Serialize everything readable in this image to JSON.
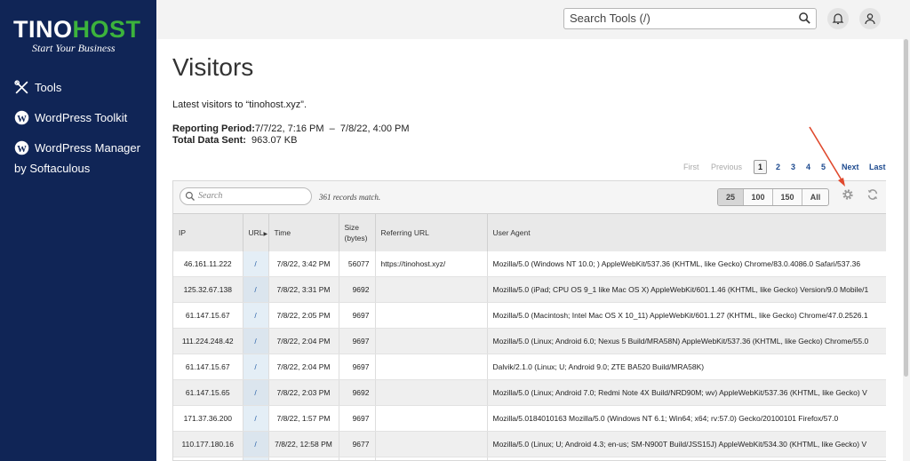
{
  "brand": {
    "name_part1": "TINO",
    "name_part2": "HOST",
    "tagline": "Start Your Business"
  },
  "sidebar": {
    "items": [
      {
        "label": "Tools",
        "icon": "tools-icon"
      },
      {
        "label": "WordPress Toolkit",
        "icon": "wordpress-icon"
      },
      {
        "label": "WordPress Manager",
        "icon": "wordpress-icon"
      }
    ],
    "sub_label": "by Softaculous"
  },
  "header": {
    "search_placeholder": "Search Tools (/)"
  },
  "page": {
    "title": "Visitors",
    "intro": "Latest visitors to “tinohost.xyz”.",
    "period_label": "Reporting Period:",
    "period_value": "7/7/22, 7:16 PM  –  7/8/22, 4:00 PM",
    "total_label": "Total Data Sent:",
    "total_value": "963.07 KB"
  },
  "pager": {
    "first": "First",
    "previous": "Previous",
    "pages": [
      "1",
      "2",
      "3",
      "4",
      "5"
    ],
    "current": "1",
    "next": "Next",
    "last": "Last"
  },
  "table": {
    "search_placeholder": "Search",
    "records": "361 records match.",
    "page_sizes": [
      "25",
      "100",
      "150",
      "All"
    ],
    "active_page_size": "25",
    "headers": {
      "ip": "IP",
      "url": "URL",
      "time": "Time",
      "size": "Size (bytes)",
      "referrer": "Referring URL",
      "agent": "User Agent"
    },
    "rows": [
      {
        "ip": "46.161.11.222",
        "url": "/",
        "time": "7/8/22, 3:42 PM",
        "size": "56077",
        "referrer": "https://tinohost.xyz/",
        "agent": "Mozilla/5.0 (Windows NT 10.0; ) AppleWebKit/537.36 (KHTML, like Gecko) Chrome/83.0.4086.0 Safari/537.36"
      },
      {
        "ip": "125.32.67.138",
        "url": "/",
        "time": "7/8/22, 3:31 PM",
        "size": "9692",
        "referrer": "",
        "agent": "Mozilla/5.0 (iPad; CPU OS 9_1 like Mac OS X) AppleWebKit/601.1.46 (KHTML, like Gecko) Version/9.0 Mobile/1"
      },
      {
        "ip": "61.147.15.67",
        "url": "/",
        "time": "7/8/22, 2:05 PM",
        "size": "9697",
        "referrer": "",
        "agent": "Mozilla/5.0 (Macintosh; Intel Mac OS X 10_11) AppleWebKit/601.1.27 (KHTML, like Gecko) Chrome/47.0.2526.1"
      },
      {
        "ip": "111.224.248.42",
        "url": "/",
        "time": "7/8/22, 2:04 PM",
        "size": "9697",
        "referrer": "",
        "agent": "Mozilla/5.0 (Linux; Android 6.0; Nexus 5 Build/MRA58N) AppleWebKit/537.36 (KHTML, like Gecko) Chrome/55.0"
      },
      {
        "ip": "61.147.15.67",
        "url": "/",
        "time": "7/8/22, 2:04 PM",
        "size": "9697",
        "referrer": "",
        "agent": "Dalvik/2.1.0 (Linux; U; Android 9.0; ZTE BA520 Build/MRA58K)"
      },
      {
        "ip": "61.147.15.65",
        "url": "/",
        "time": "7/8/22, 2:03 PM",
        "size": "9692",
        "referrer": "",
        "agent": "Mozilla/5.0 (Linux; Android 7.0; Redmi Note 4X Build/NRD90M; wv) AppleWebKit/537.36 (KHTML, like Gecko) V"
      },
      {
        "ip": "171.37.36.200",
        "url": "/",
        "time": "7/8/22, 1:57 PM",
        "size": "9697",
        "referrer": "",
        "agent": "Mozilla/5.0184010163 Mozilla/5.0 (Windows NT 6.1; Win64; x64; rv:57.0) Gecko/20100101 Firefox/57.0"
      },
      {
        "ip": "110.177.180.16",
        "url": "/",
        "time": "7/8/22, 12:58 PM",
        "size": "9677",
        "referrer": "",
        "agent": "Mozilla/5.0 (Linux; U; Android 4.3; en-us; SM-N900T Build/JSS15J) AppleWebKit/534.30 (KHTML, like Gecko) V"
      },
      {
        "ip": "",
        "url": "",
        "time": "",
        "size": "",
        "referrer": "",
        "agent": ""
      }
    ]
  },
  "colors": {
    "sidebar": "#102556",
    "brand_green": "#3cb33c",
    "link": "#1d4a8f",
    "annotation_arrow": "#e0492d"
  }
}
